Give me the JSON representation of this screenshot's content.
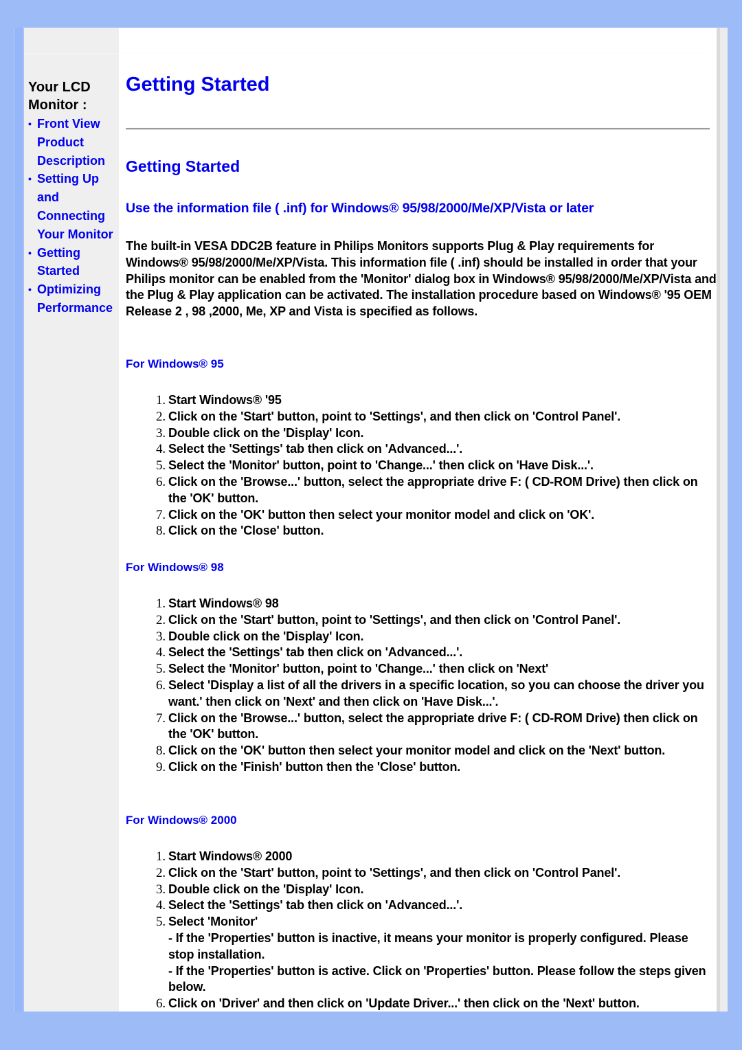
{
  "sidebar": {
    "title": "Your LCD Monitor :",
    "items": [
      {
        "label": "Front View Product Description"
      },
      {
        "label": "Setting Up and Connecting Your Monitor"
      },
      {
        "label": "Getting Started"
      },
      {
        "label": "Optimizing Performance"
      }
    ],
    "bullet": "•"
  },
  "main": {
    "page_title": "Getting Started",
    "section_title": "Getting Started",
    "inf_title": "Use the information file ( .inf) for Windows® 95/98/2000/Me/XP/Vista or later",
    "intro": "The built-in VESA DDC2B feature in Philips Monitors supports Plug & Play requirements for Windows® 95/98/2000/Me/XP/Vista. This information file ( .inf) should be installed in order that your Philips monitor can be enabled from the 'Monitor' dialog box in Windows® 95/98/2000/Me/XP/Vista and the Plug & Play application can be activated. The installation procedure based on Windows® '95 OEM Release 2 , 98 ,2000, Me, XP and Vista is specified as follows.",
    "sections": [
      {
        "heading": "For Windows® 95",
        "steps": [
          {
            "num": "1.",
            "text": "Start Windows® '95"
          },
          {
            "num": "2.",
            "text": "Click on the 'Start' button, point to 'Settings', and then click on 'Control Panel'."
          },
          {
            "num": "3.",
            "text": "Double click on the 'Display' Icon."
          },
          {
            "num": "4.",
            "text": "Select the 'Settings' tab then click on 'Advanced...'."
          },
          {
            "num": "5.",
            "text": "Select the 'Monitor' button, point to 'Change...' then click on 'Have Disk...'."
          },
          {
            "num": "6.",
            "text": "Click on the 'Browse...' button, select the appropriate drive F: ( CD-ROM Drive) then click on the 'OK' button."
          },
          {
            "num": "7.",
            "text": "Click on the 'OK' button then select your monitor model and click on 'OK'."
          },
          {
            "num": "8.",
            "text": "Click on the 'Close' button."
          }
        ]
      },
      {
        "heading": "For Windows® 98",
        "steps": [
          {
            "num": "1.",
            "text": "Start Windows® 98"
          },
          {
            "num": "2.",
            "text": "Click on the 'Start' button, point to 'Settings', and then click on 'Control Panel'."
          },
          {
            "num": "3.",
            "text": "Double click on the 'Display' Icon."
          },
          {
            "num": "4.",
            "text": "Select the 'Settings' tab then click on 'Advanced...'."
          },
          {
            "num": "5.",
            "text": "Select the 'Monitor' button, point to 'Change...' then click on 'Next'"
          },
          {
            "num": "6.",
            "text": "Select 'Display a list of all the drivers in a specific location, so you can choose the driver you want.' then click on 'Next' and then click on 'Have Disk...'."
          },
          {
            "num": "7.",
            "text": "Click on the 'Browse...' button, select the appropriate drive F: ( CD-ROM Drive) then click on the 'OK' button."
          },
          {
            "num": "8.",
            "text": "Click on the 'OK' button then select your monitor model and click on the 'Next' button."
          },
          {
            "num": "9.",
            "text": "Click on the 'Finish' button then the 'Close' button."
          }
        ]
      },
      {
        "heading": "For Windows® 2000",
        "steps": [
          {
            "num": "1.",
            "text": "Start Windows® 2000"
          },
          {
            "num": "2.",
            "text": "Click on the 'Start' button, point to 'Settings', and then click on 'Control Panel'."
          },
          {
            "num": "3.",
            "text": "Double click on the 'Display' Icon."
          },
          {
            "num": "4.",
            "text": "Select the 'Settings' tab then click on 'Advanced...'."
          },
          {
            "num": "5.",
            "text": "Select 'Monitor'",
            "subs": [
              "- If the 'Properties' button is inactive, it means your monitor is properly configured. Please stop installation.",
              "- If the 'Properties' button is active. Click on 'Properties' button. Please follow the steps given below."
            ]
          },
          {
            "num": "6.",
            "text": "Click on 'Driver' and then click on 'Update Driver...' then click on the 'Next' button."
          }
        ]
      }
    ]
  },
  "colors": {
    "background": "#9dbcf7",
    "link": "#0000ee",
    "sidebar": "#efefef",
    "rule": "#9b9b9b"
  }
}
